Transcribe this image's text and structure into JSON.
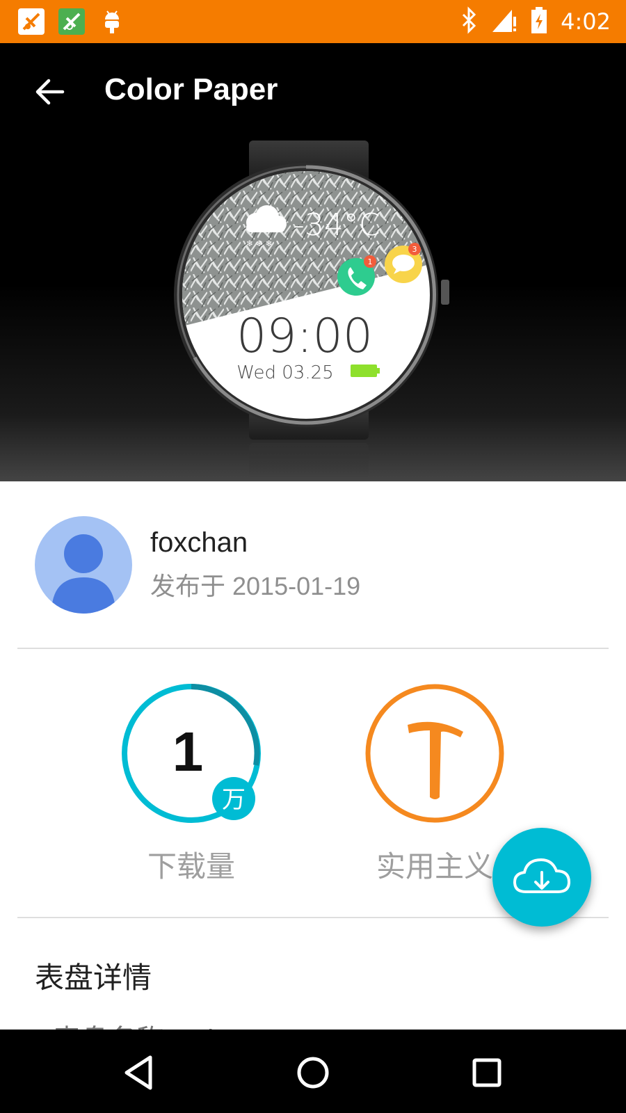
{
  "status_bar": {
    "time": "4:02",
    "notification_icons": [
      "app-notification-icon-1",
      "app-notification-icon-2",
      "android-debug-icon"
    ],
    "indicator_icons": [
      "bluetooth-icon",
      "cell-signal-icon",
      "battery-charging-icon"
    ],
    "background_color": "#F57C00"
  },
  "app_bar": {
    "title": "Color Paper",
    "back_icon": "arrow-back-icon"
  },
  "watch_preview": {
    "temperature": "-34°C",
    "time": "09:00",
    "date": "Wed 03.25",
    "call_badge": "1",
    "message_badge": "3"
  },
  "author": {
    "name": "foxchan",
    "published": "发布于 2015-01-19"
  },
  "stats": {
    "downloads_value": "1",
    "downloads_unit": "万",
    "downloads_label": "下载量",
    "style_label": "实用主义",
    "accent_download": "#00BCD4",
    "accent_style": "#F5891F"
  },
  "fab": {
    "icon": "cloud-download-icon",
    "color": "#00BCD4"
  },
  "details": {
    "section_title": "表盘详情",
    "row_partial": "表盘名称      Color Paper"
  },
  "nav_bar": {
    "back_icon": "nav-back-icon",
    "home_icon": "nav-home-icon",
    "recents_icon": "nav-recents-icon"
  }
}
